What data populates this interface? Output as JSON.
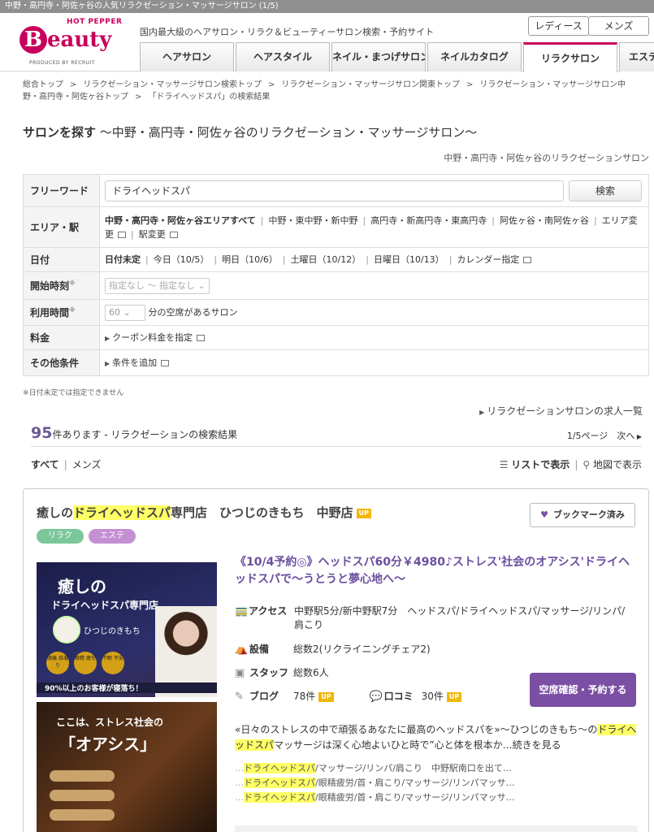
{
  "window": {
    "title": "中野・高円寺・阿佐ヶ谷の人気リラクゼーション・マッサージサロン (1/5)"
  },
  "header": {
    "logo_top": "HOT PEPPER",
    "logo_badge": "B",
    "logo_word": "eauty",
    "logo_produced": "PRODUCED BY RECRUIT",
    "tagline": "国内最大級のヘアサロン・リラク＆ビューティーサロン検索・予約サイト",
    "gender_tabs": [
      "レディース",
      "メンズ"
    ],
    "nav_tabs": [
      "ヘアサロン",
      "ヘアスタイル",
      "ネイル・まつげサロン",
      "ネイルカタログ",
      "リラクサロン",
      "エステ"
    ],
    "active_tab": "リラクサロン"
  },
  "breadcrumb": [
    "総合トップ",
    "リラクゼーション・マッサージサロン検索トップ",
    "リラクゼーション・マッサージサロン関東トップ",
    "リラクゼーション・マッサージサロン中野・高円寺・阿佐ヶ谷トップ",
    "「ドライヘッドスパ」の検索結果"
  ],
  "page": {
    "title_bold": "サロンを探す",
    "title_rest": "～中野・高円寺・阿佐ヶ谷のリラクゼーション・マッサージサロン～",
    "subtitle_right": "中野・高円寺・阿佐ヶ谷のリラクゼーションサロン"
  },
  "search": {
    "freeword_label": "フリーワード",
    "freeword_value": "ドライヘッドスパ",
    "search_button": "検索",
    "area_label": "エリア・駅",
    "area_selected": "中野・高円寺・阿佐ヶ谷エリアすべて",
    "area_options": [
      "中野・東中野・新中野",
      "高円寺・新高円寺・東高円寺",
      "阿佐ヶ谷・南阿佐ヶ谷"
    ],
    "area_change": "エリア変更",
    "station_change": "駅変更",
    "date_label": "日付",
    "date_selected": "日付未定",
    "date_options": [
      "今日（10/5）",
      "明日（10/6）",
      "土曜日（10/12）",
      "日曜日（10/13）"
    ],
    "calendar": "カレンダー指定",
    "start_label": "開始時刻",
    "start_placeholder": "指定なし ～ 指定なし",
    "duration_label": "利用時間",
    "duration_value": "60",
    "duration_suffix": "分の空席があるサロン",
    "price_label": "料金",
    "price_link": "クーポン料金を指定",
    "other_label": "その他条件",
    "other_link": "条件を追加",
    "note": "※日付未定では指定できません"
  },
  "results": {
    "jobs_link": "リラクゼーションサロンの求人一覧",
    "count": "95",
    "count_text": "件あります - リラクゼーションの検索結果",
    "page_info": "1/5ページ",
    "next": "次へ",
    "filter_all": "すべて",
    "filter_mens": "メンズ",
    "list_view": "リストで表示",
    "map_view": "地図で表示"
  },
  "salon": {
    "name_pre": "癒しの",
    "name_hl": "ドライヘッドスパ",
    "name_post": "専門店　ひつじのきもち　中野店",
    "up": "UP",
    "bookmark": "ブックマーク済み",
    "tags": [
      "リラク",
      "エステ"
    ],
    "img_title": "癒しの",
    "img_sub": "ドライヘッドスパ専門店",
    "img_brand": "ひつじのきもち",
    "img_circles": [
      "頭痛 肩凝り",
      "眼精 疲労",
      "不眠 不安"
    ],
    "img_footer": "90%以上のお客様が寝落ち！",
    "img2_line1": "ここは、ストレス社会の",
    "img2_line2": "「オアシス」",
    "lead": "《10/4予約◎》ヘッドスパ60分￥4980♪ストレス'社会のオアシス'ドライヘッドスパで～うとうと夢心地へ～",
    "access_label": "アクセス",
    "access_value": "中野駅5分/新中野駅7分　ヘッドスパ/ドライヘッドスパ/マッサージ/リンパ/肩こり",
    "equip_label": "設備",
    "equip_value": "総数2(リクライニングチェア2)",
    "staff_label": "スタッフ",
    "staff_value": "総数6人",
    "blog_label": "ブログ",
    "blog_value": "78件",
    "review_label": "口コミ",
    "review_value": "30件",
    "cta": "空席確認・予約する",
    "desc_pre": "«日々のストレスの中で頑張るあなたに最高のヘッドスパを»～ひつじのきもち～の",
    "desc_hl": "ドライヘッドスパ",
    "desc_post": "マッサージは深く心地よいひと時で”心と体を根本か…続きを見る",
    "keywords": [
      {
        "hl": "ドライヘッドスパ",
        "rest": "/マッサージ/リンパ/肩こり　中野駅南口を出て…"
      },
      {
        "hl": "ドライヘッドスパ",
        "rest": "/眼精疲労/首・肩こり/マッサージ/リンパマッサ…"
      },
      {
        "hl": "ドライヘッドスパ",
        "rest": "/眼精疲労/首・肩こり/マッサージ/リンパマッサ…"
      }
    ]
  },
  "colors": {
    "brand": "#c9005b",
    "accent": "#7b4fa3",
    "highlight": "#ffff66"
  }
}
